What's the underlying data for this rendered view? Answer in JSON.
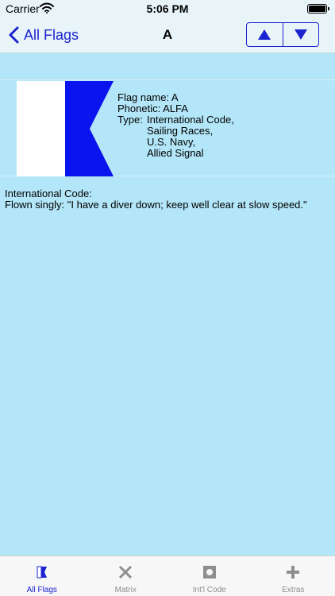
{
  "status_bar": {
    "carrier": "Carrier",
    "time": "5:06 PM"
  },
  "nav": {
    "back_label": "All Flags",
    "title": "A",
    "accent_color": "#1b24d0"
  },
  "flag": {
    "name_line": "Flag name: A",
    "phonetic_line": "Phonetic: ALFA",
    "type_label": "Type:",
    "types": [
      "International Code,",
      "Sailing Races,",
      "U.S. Navy,",
      "Allied Signal"
    ],
    "colors": {
      "hoist": "#ffffff",
      "fly": "#0a14ee"
    }
  },
  "description": {
    "heading": "International Code:",
    "text": "Flown singly: \"I have a diver down; keep well clear at slow speed.\""
  },
  "tab_bar": {
    "tabs": [
      {
        "label": "All Flags",
        "icon": "flag-icon",
        "active": true
      },
      {
        "label": "Matrix",
        "icon": "cross-icon",
        "active": false
      },
      {
        "label": "Int'l Code",
        "icon": "square-dot-icon",
        "active": false
      },
      {
        "label": "Extras",
        "icon": "plus-icon",
        "active": false
      }
    ]
  }
}
